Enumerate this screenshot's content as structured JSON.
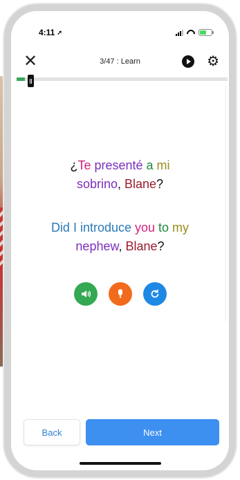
{
  "status_bar": {
    "time": "4:11"
  },
  "header": {
    "progress_label": "3/47 : Learn",
    "close_icon": "close-icon",
    "play_icon": "play-icon",
    "settings_icon": "gear-icon"
  },
  "progress": {
    "fraction": 0.04
  },
  "prompt": {
    "spanish": [
      {
        "text": "¿",
        "color": "#111111"
      },
      {
        "text": "Te",
        "color": "#d6217e"
      },
      {
        "text": " presenté",
        "color": "#7b2fbe"
      },
      {
        "text": " a",
        "color": "#1e8a3c"
      },
      {
        "text": " mi",
        "color": "#9a8c1d"
      },
      {
        "text": "sobrino",
        "color": "#7b2fbe"
      },
      {
        "text": ", ",
        "color": "#111111"
      },
      {
        "text": "Blane",
        "color": "#9b1c2e"
      },
      {
        "text": "?",
        "color": "#111111"
      }
    ],
    "english": [
      {
        "text": "Did I introduce",
        "color": "#2a79b8"
      },
      {
        "text": " you",
        "color": "#d6217e"
      },
      {
        "text": " to",
        "color": "#1e8a3c"
      },
      {
        "text": " my",
        "color": "#9a8c1d"
      },
      {
        "text": "nephew",
        "color": "#7b2fbe"
      },
      {
        "text": ", ",
        "color": "#111111"
      },
      {
        "text": "Blane",
        "color": "#9b1c2e"
      },
      {
        "text": "?",
        "color": "#111111"
      }
    ]
  },
  "audio_controls": {
    "speaker_icon": "speaker-icon",
    "mic_icon": "microphone-icon",
    "replay_icon": "replay-icon"
  },
  "buttons": {
    "back": "Back",
    "next": "Next"
  },
  "colors": {
    "accent": "#3d8ff0",
    "progress": "#3aa757",
    "speaker": "#34a853",
    "mic": "#f26b1d",
    "replay": "#1e88e5"
  }
}
